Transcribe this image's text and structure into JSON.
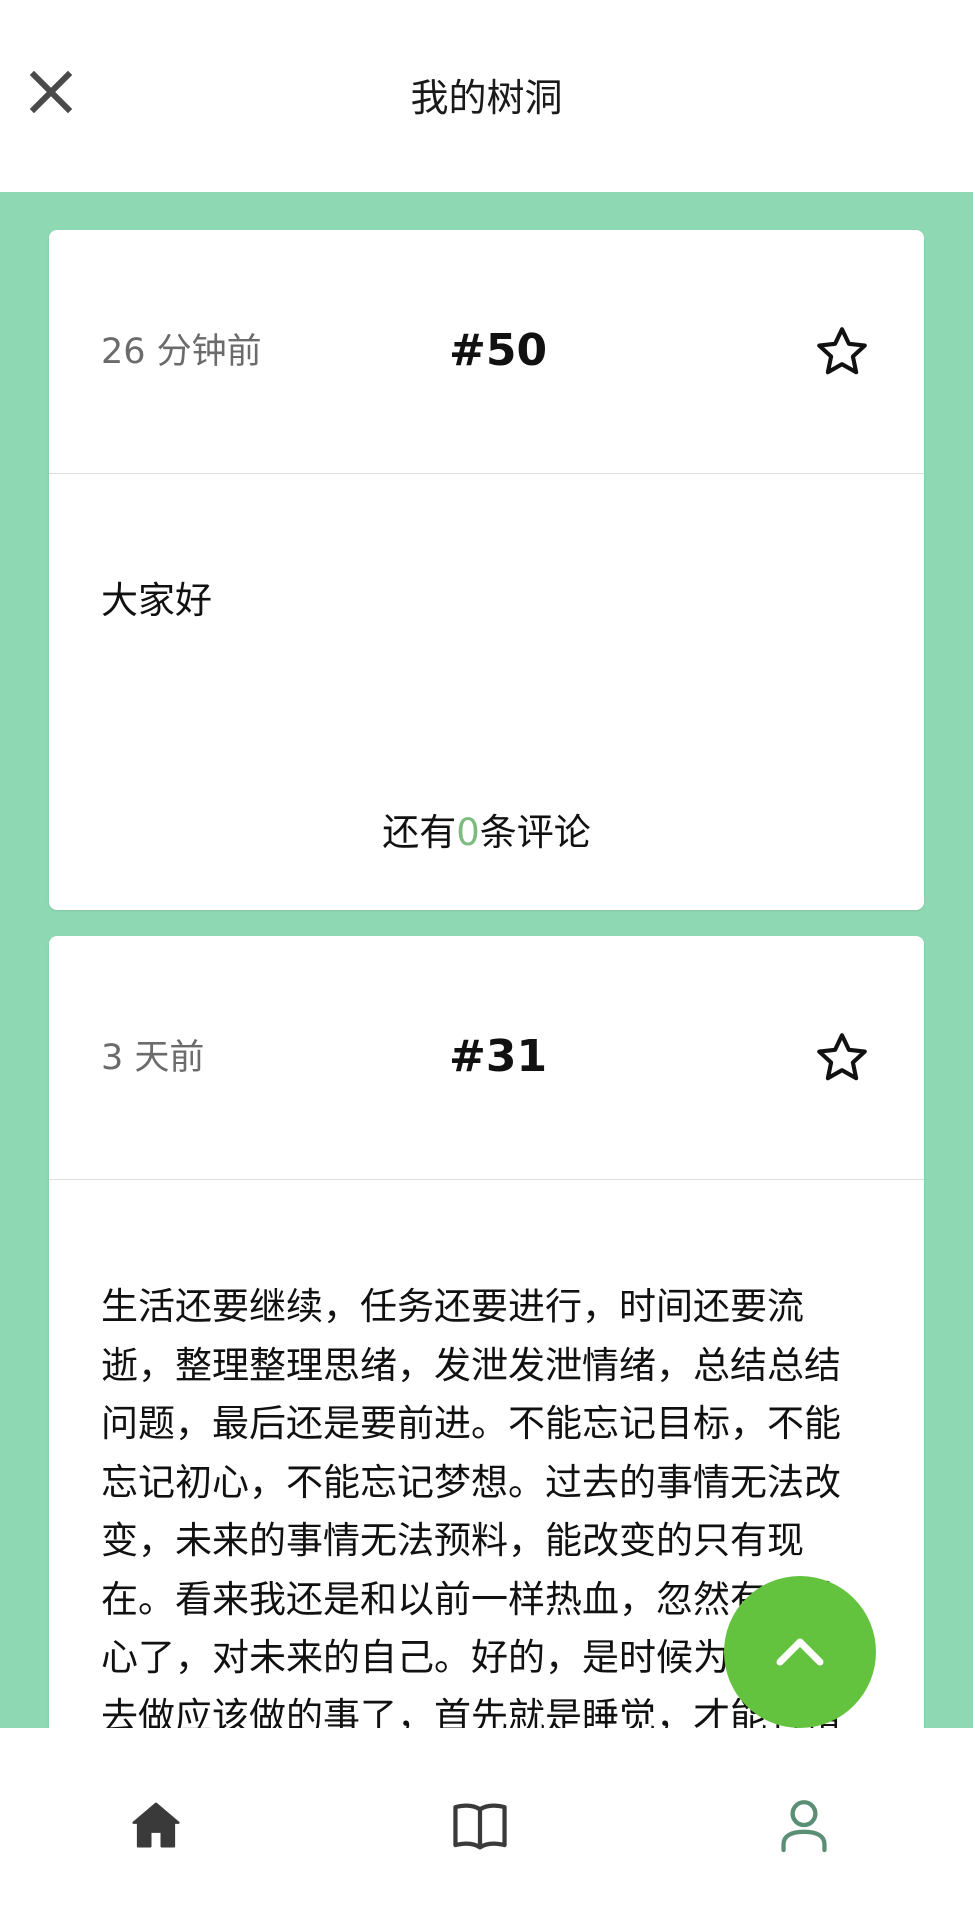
{
  "header": {
    "title": "我的树洞"
  },
  "posts": [
    {
      "time": "26 分钟前",
      "id": "#50",
      "content": "大家好",
      "comments_prefix": "还有",
      "comments_count": "0",
      "comments_suffix": "条评论"
    },
    {
      "time": "3 天前",
      "id": "#31",
      "content_lines": [
        "生活还要继续，任务还要进行，时间还要流",
        "逝，整理整理思绪，发泄发泄情绪，总结总结",
        "问题，最后还是要前进。不能忘记目标，不能",
        "忘记初心，不能忘记梦想。过去的事情无法改",
        "变，未来的事情无法预料，能改变的只有现",
        "在。看来我还是和以前一样热血，忽然有点放",
        "心了，对未来的自己。好的，是时候为了目标",
        "去做应该做的事了，首先就是睡觉，才能有精"
      ]
    }
  ],
  "colors": {
    "background": "#8ed8b3",
    "fab": "#64c33e",
    "accent_count": "#7dbb7f",
    "nav_active": "#5a8f75"
  },
  "icons": {
    "close": "close-icon",
    "star": "star-outline-icon",
    "fab": "chevron-up-icon",
    "nav_home": "home-icon",
    "nav_book": "book-icon",
    "nav_profile": "person-icon"
  }
}
